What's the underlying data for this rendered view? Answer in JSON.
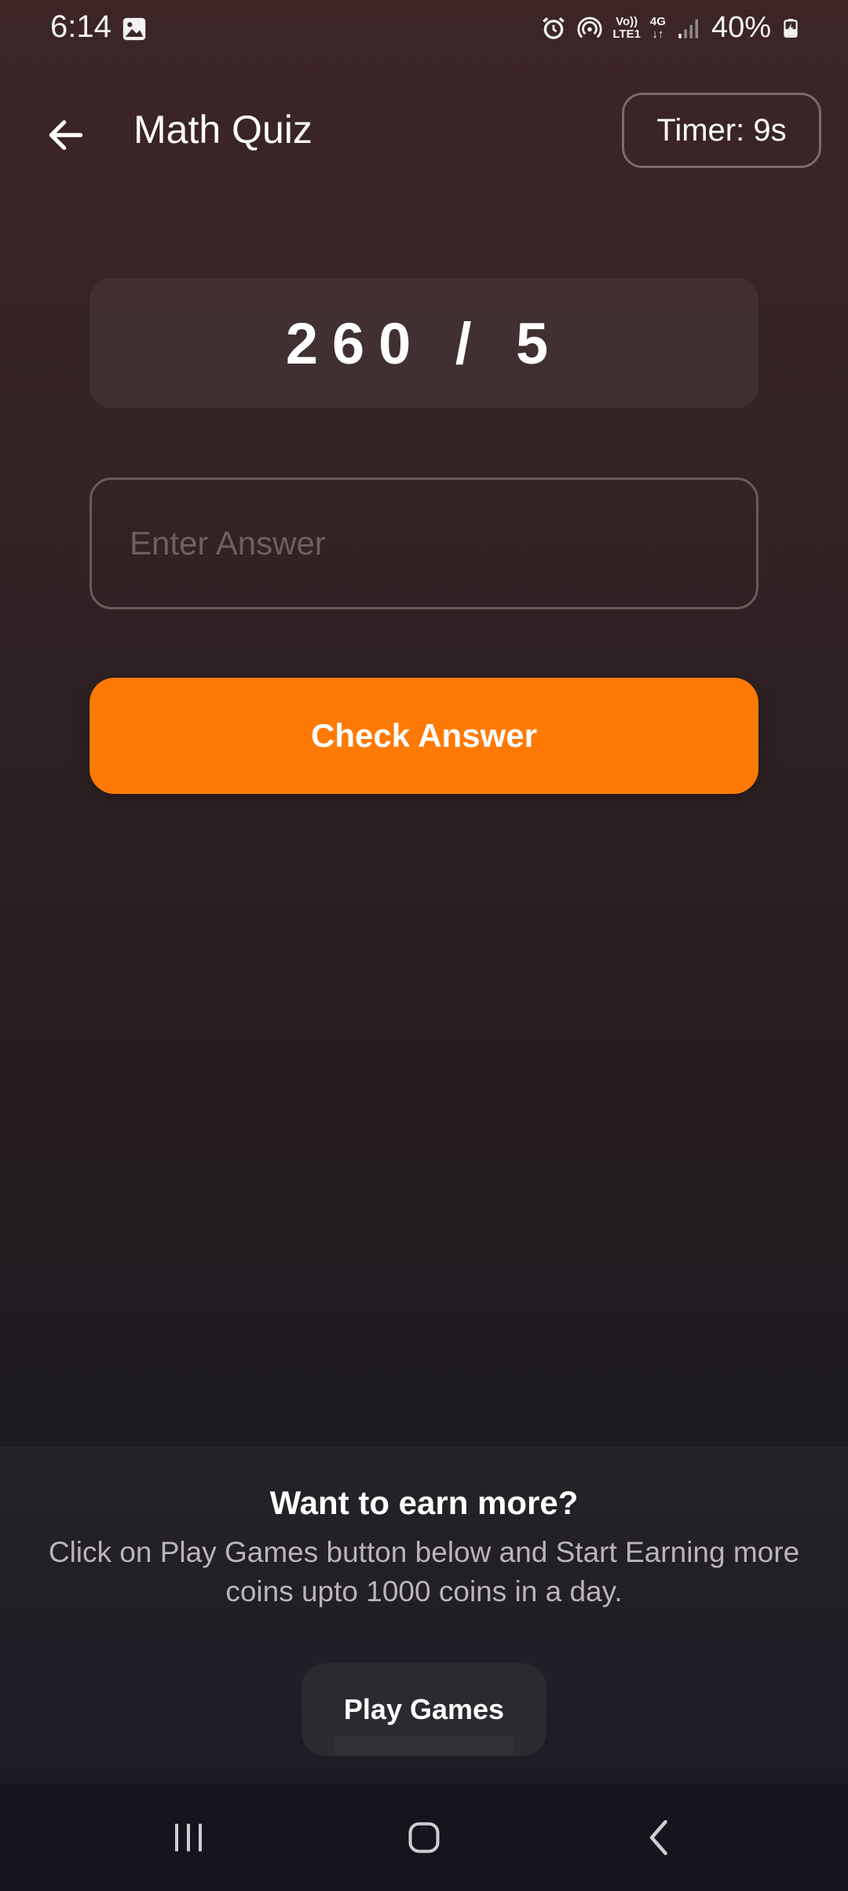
{
  "status_bar": {
    "time": "6:14",
    "lte_top": "Vo))",
    "lte_bottom": "LTE1",
    "network": "4G",
    "battery": "40%"
  },
  "app_bar": {
    "title": "Math Quiz",
    "timer": "Timer: 9s"
  },
  "question": {
    "text": "260 / 5"
  },
  "answer": {
    "placeholder": "Enter Answer",
    "value": ""
  },
  "check_button": {
    "label": "Check Answer"
  },
  "earn_more": {
    "title": "Want to earn more?",
    "description": "Click on Play Games button below and Start Earning more coins upto 1000 coins in a day.",
    "button_label": "Play Games"
  },
  "colors": {
    "accent": "#ff7a05",
    "background_top": "#3d2526",
    "background_bottom": "#1e1b22"
  }
}
